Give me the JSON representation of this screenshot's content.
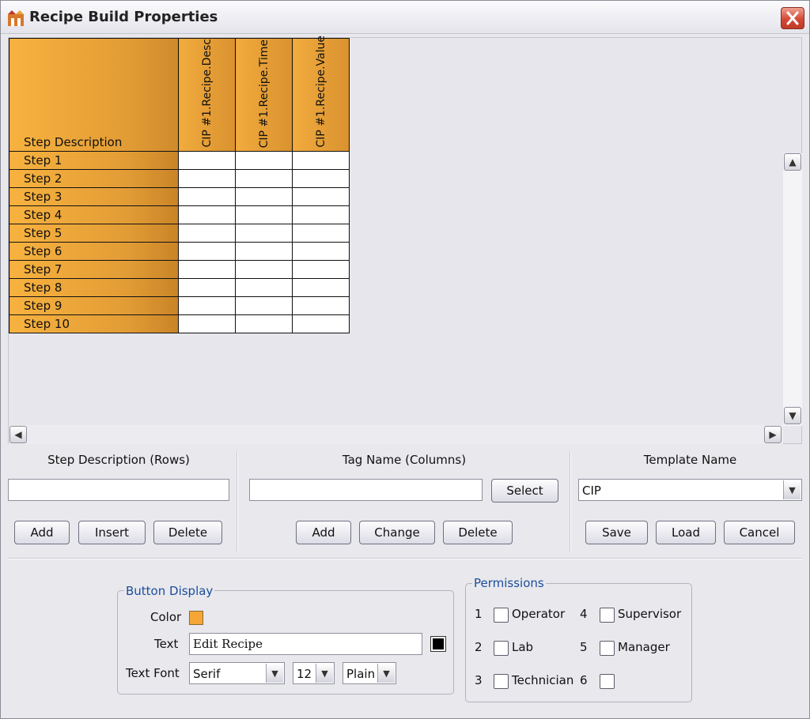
{
  "window": {
    "title": "Recipe Build Properties"
  },
  "grid": {
    "row_header": "Step Description",
    "columns": [
      "CIP #1.Recipe.Desc",
      "CIP #1.Recipe.Time",
      "CIP #1.Recipe.Value"
    ],
    "rows": [
      "Step 1",
      "Step 2",
      "Step 3",
      "Step 4",
      "Step 5",
      "Step 6",
      "Step 7",
      "Step 8",
      "Step 9",
      "Step 10"
    ]
  },
  "rows_section": {
    "title": "Step Description (Rows)",
    "input_value": "",
    "add": "Add",
    "insert": "Insert",
    "delete": "Delete"
  },
  "columns_section": {
    "title": "Tag Name (Columns)",
    "input_value": "",
    "select": "Select",
    "add": "Add",
    "change": "Change",
    "delete": "Delete"
  },
  "template_section": {
    "title": "Template Name",
    "selected": "CIP",
    "save": "Save",
    "load": "Load",
    "cancel": "Cancel"
  },
  "button_display": {
    "title": "Button Display",
    "color_label": "Color",
    "color_value": "#f5a637",
    "text_label": "Text",
    "text_value": "Edit Recipe",
    "text_color": "#000000",
    "font_label": "Text Font",
    "font_family": "Serif",
    "font_size": "12",
    "font_style": "Plain"
  },
  "permissions": {
    "title": "Permissions",
    "items": [
      {
        "num": "1",
        "label": "Operator",
        "checked": false
      },
      {
        "num": "2",
        "label": "Lab",
        "checked": false
      },
      {
        "num": "3",
        "label": "Technician",
        "checked": false
      },
      {
        "num": "4",
        "label": "Supervisor",
        "checked": false
      },
      {
        "num": "5",
        "label": "Manager",
        "checked": false
      },
      {
        "num": "6",
        "label": "",
        "checked": false
      }
    ]
  }
}
